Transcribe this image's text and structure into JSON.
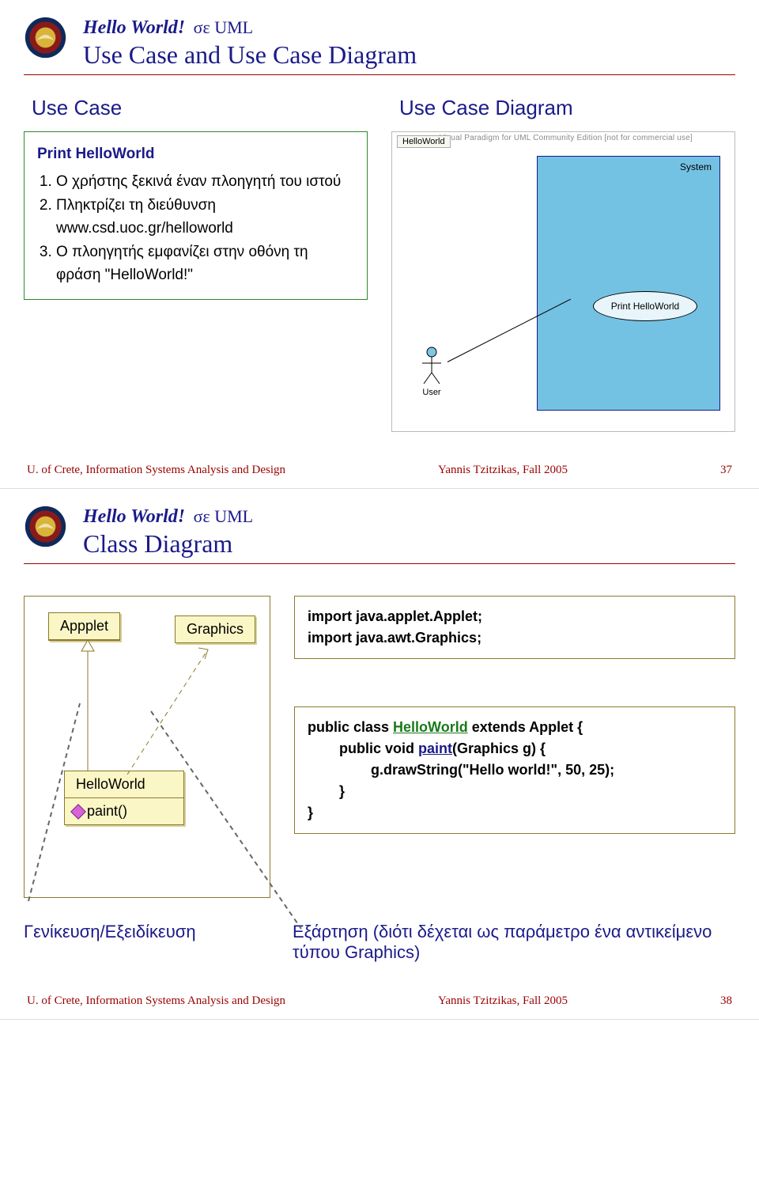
{
  "slide1": {
    "helloWorld": "Hello World!",
    "inUml": "σε UML",
    "subtitle": "Use Case and Use Case Diagram",
    "leftHead": "Use Case",
    "rightHead": "Use Case Diagram",
    "usecase": {
      "title": "Print HelloWorld",
      "li1": "Ο χρήστης ξεκινά έναν πλοηγητή του ιστού",
      "li2": "Πληκτρίζει  τη διεύθυνση www.csd.uoc.gr/helloworld",
      "li3": "Ο πλοηγητής εμφανίζει στην οθόνη τη φράση \"HelloWorld!\""
    },
    "ucd": {
      "tab": "HelloWorld",
      "watermark": "Visual Paradigm for UML Community Edition [not for commercial use]",
      "system": "System",
      "oval": "Print HelloWorld",
      "actor": "User"
    },
    "footer": {
      "left": "U. of Crete, Information Systems Analysis and Design",
      "mid": "Yannis Tzitzikas, Fall 2005",
      "page": "37"
    }
  },
  "slide2": {
    "helloWorld": "Hello World!",
    "inUml": "σε UML",
    "subtitle": "Class Diagram",
    "classes": {
      "applet": "Appplet",
      "graphics": "Graphics",
      "hello": "HelloWorld",
      "method": "paint()"
    },
    "code1a": "import java.applet.Applet;",
    "code1b": "import java.awt.Graphics;",
    "code2a_pre": "public class ",
    "code2a_link": "HelloWorld",
    "code2a_post": " extends Applet {",
    "code2b_pre": "public void ",
    "code2b_link": "paint",
    "code2b_post": "(Graphics g) {",
    "code2c": "g.drawString(\"Hello world!\", 50, 25);",
    "code2d": "}",
    "code2e": "}",
    "annot1": "Γενίκευση/Εξειδίκευση",
    "annot2": "Εξάρτηση (διότι δέχεται ως παράμετρο ένα αντικείμενο τύπου Graphics)",
    "footer": {
      "left": "U. of Crete, Information Systems Analysis and Design",
      "mid": "Yannis Tzitzikas, Fall 2005",
      "page": "38"
    }
  }
}
